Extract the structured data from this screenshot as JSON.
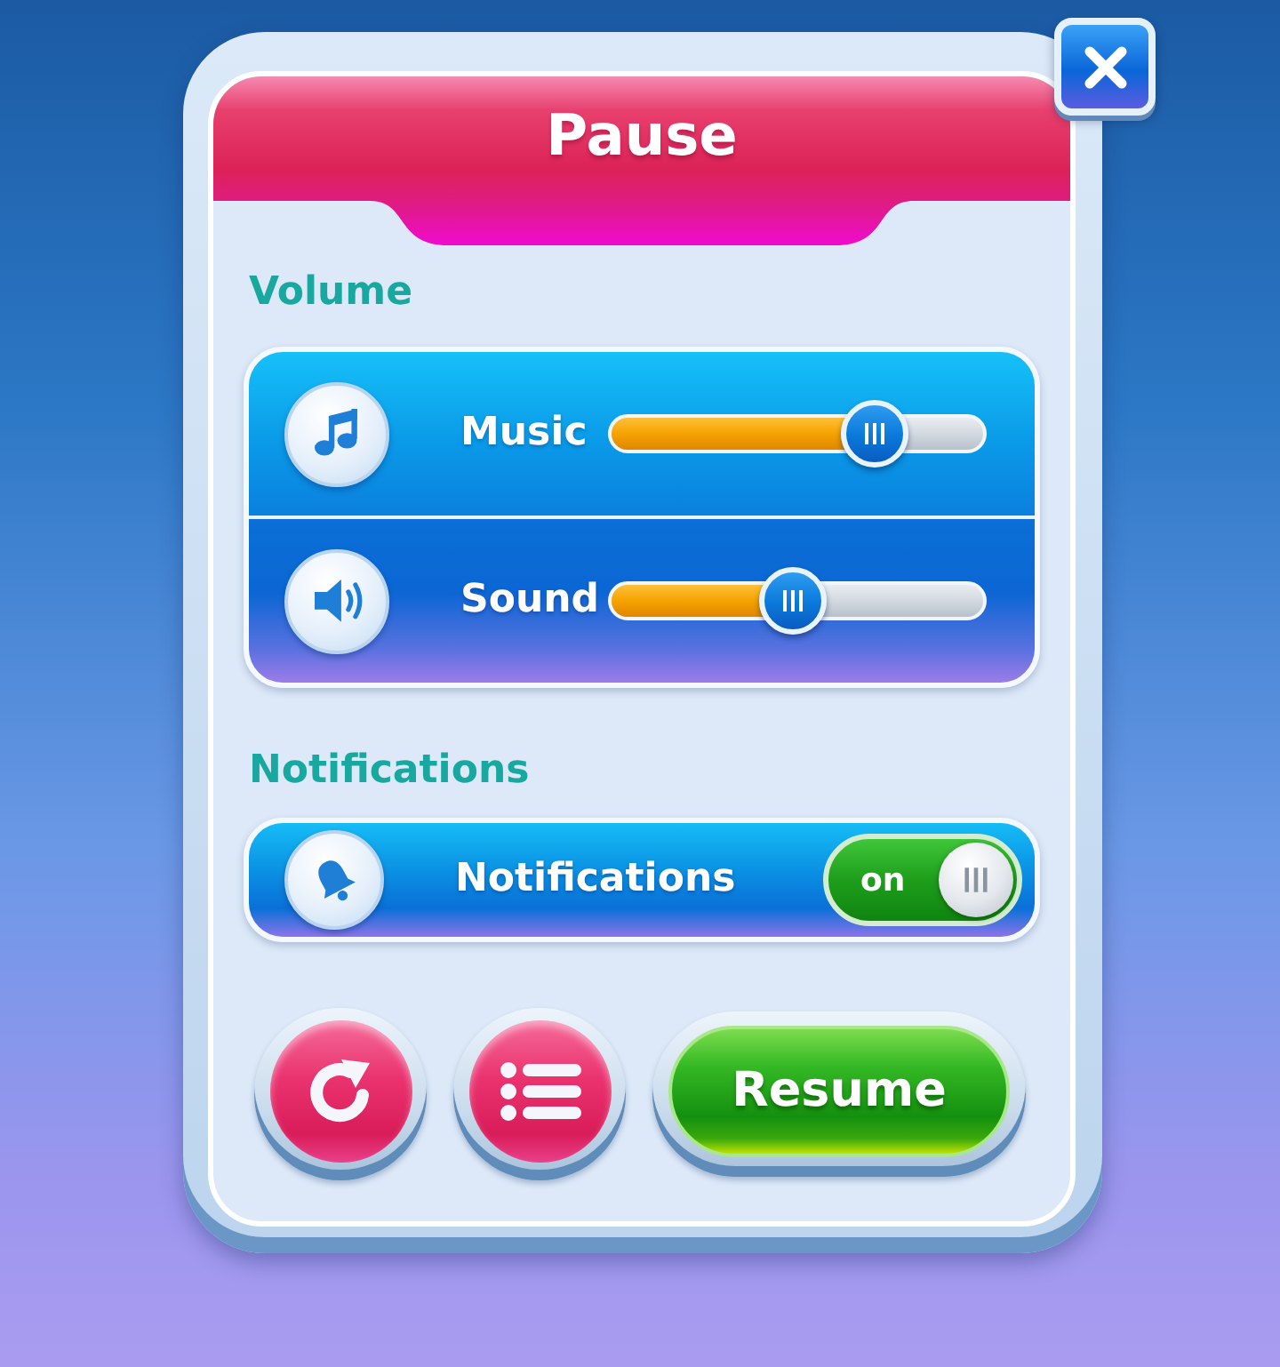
{
  "title": "Pause",
  "volume": {
    "heading": "Volume",
    "rows": [
      {
        "label": "Music",
        "level": 0.71
      },
      {
        "label": "Sound",
        "level": 0.49
      }
    ]
  },
  "notifications": {
    "heading": "Notifications",
    "rows": [
      {
        "label": "Notifications",
        "on": true,
        "switch_text": "on"
      }
    ]
  },
  "resume_button": {
    "label": "Resume"
  }
}
